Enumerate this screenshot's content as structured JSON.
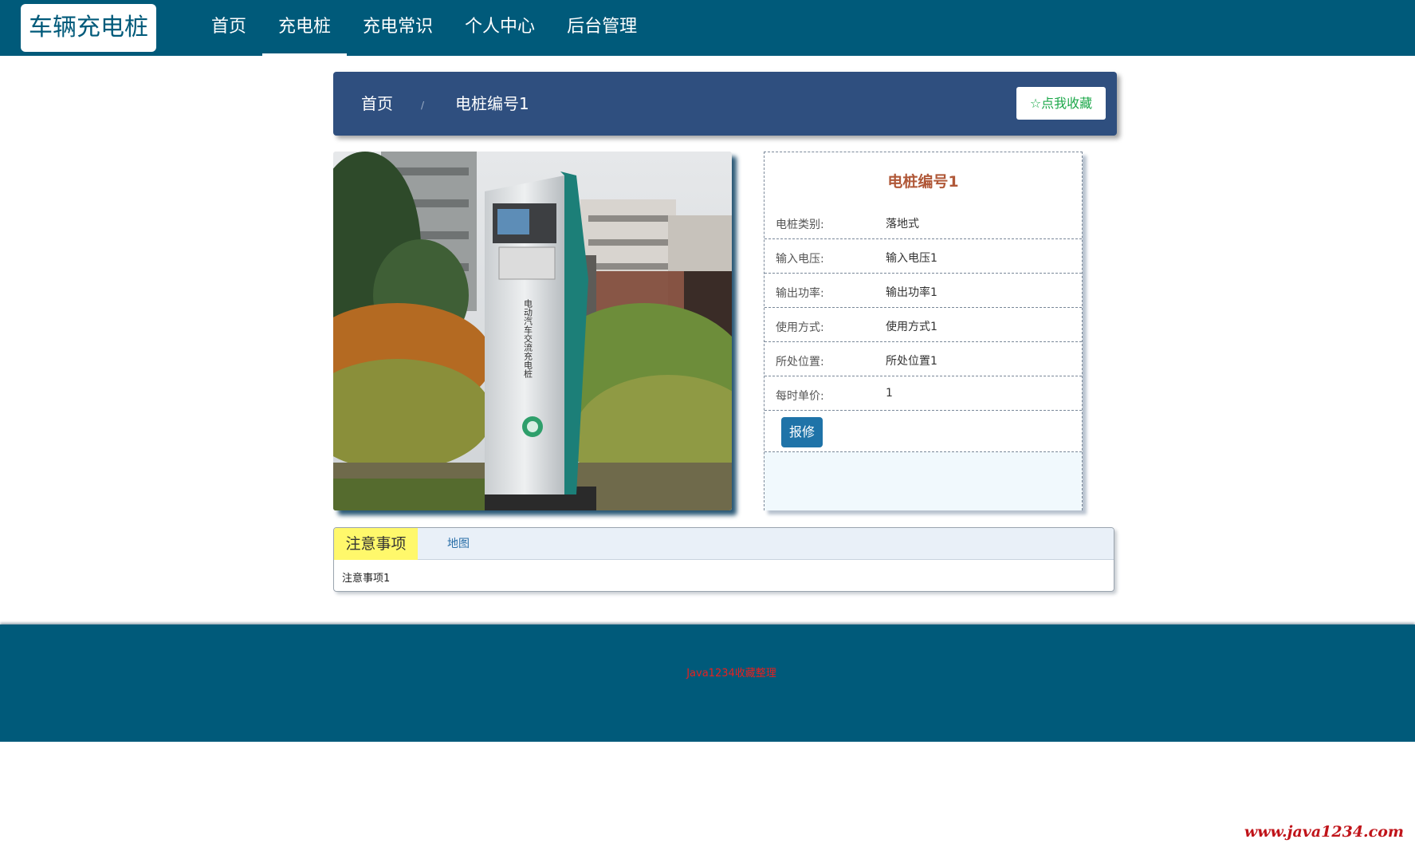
{
  "header": {
    "brand": "车辆充电桩",
    "nav": [
      {
        "label": "首页"
      },
      {
        "label": "充电桩"
      },
      {
        "label": "充电常识"
      },
      {
        "label": "个人中心"
      },
      {
        "label": "后台管理"
      }
    ],
    "active_index": 1
  },
  "breadcrumb": {
    "home": "首页",
    "separator": "/",
    "current": "电桩编号1",
    "favorite_button": "☆点我收藏"
  },
  "detail": {
    "title": "电桩编号1",
    "fields": [
      {
        "label": "电桩类别:",
        "value": "落地式"
      },
      {
        "label": "输入电压:",
        "value": "输入电压1"
      },
      {
        "label": "输出功率:",
        "value": "输出功率1"
      },
      {
        "label": "使用方式:",
        "value": "使用方式1"
      },
      {
        "label": "所处位置:",
        "value": "所处位置1"
      },
      {
        "label": "每时单价:",
        "value": "1"
      }
    ],
    "repair_button": "报修"
  },
  "photo": {
    "pile_vertical_text": "电动汽车交流充电桩"
  },
  "tabs": {
    "items": [
      {
        "label": "注意事项"
      },
      {
        "label": "地图"
      }
    ],
    "content": "注意事项1"
  },
  "footer": {
    "text": "Java1234收藏整理"
  },
  "watermark": "www.java1234.com",
  "colors": {
    "nav_bg": "#005a7a",
    "crumb_bg": "#2f4f7f",
    "title_color": "#b05838",
    "button_blue": "#1f73a8",
    "tab_active": "#fff86b",
    "footer_text": "#e8201f"
  }
}
